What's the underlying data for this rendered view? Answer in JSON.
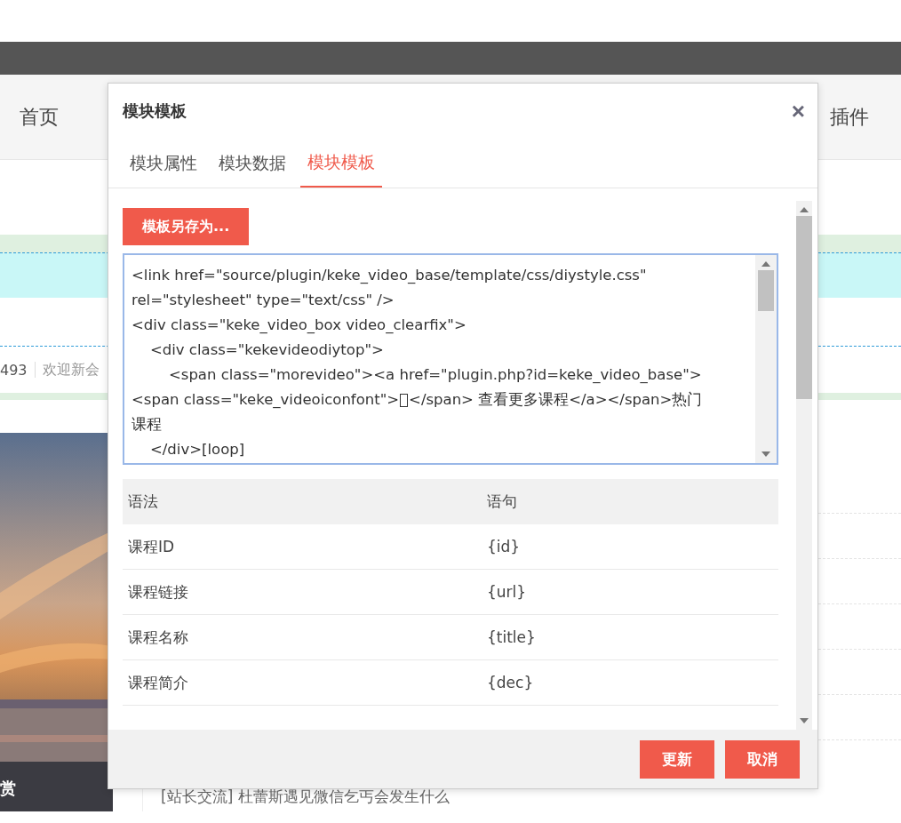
{
  "page": {
    "nav": [
      "首页",
      "插件"
    ],
    "stats": {
      "count": "493",
      "welcome": "欢迎新会"
    },
    "photo_caption": "赏",
    "news": "[站长交流]  杜蕾斯遇见微信乞丐会发生什么"
  },
  "dialog": {
    "title": "模块模板",
    "close": "×",
    "tabs": [
      {
        "label": "模块属性",
        "selected": false
      },
      {
        "label": "模块数据",
        "selected": false
      },
      {
        "label": "模块模板",
        "selected": true
      }
    ],
    "save_as_button": "模板另存为...",
    "code_lines": [
      "<link href=\"source/plugin/keke_video_base/template/css/diystyle.css\"",
      "rel=\"stylesheet\" type=\"text/css\" />",
      "<div class=\"keke_video_box video_clearfix\">",
      "    <div class=\"kekevideodiytop\">",
      "        <span class=\"morevideo\"><a href=\"plugin.php?id=keke_video_base\">",
      {
        "before": "<span class=\"keke_videoiconfont\">",
        "after": "</span> 查看更多课程</a></span>热门"
      },
      "课程",
      "    </div>[loop]"
    ],
    "table": {
      "columns": [
        "语法",
        "语句"
      ],
      "rows": [
        [
          "课程ID",
          "{id}"
        ],
        [
          "课程链接",
          "{url}"
        ],
        [
          "课程名称",
          "{title}"
        ],
        [
          "课程简介",
          "{dec}"
        ]
      ]
    },
    "buttons": [
      "更新",
      "取消"
    ]
  }
}
